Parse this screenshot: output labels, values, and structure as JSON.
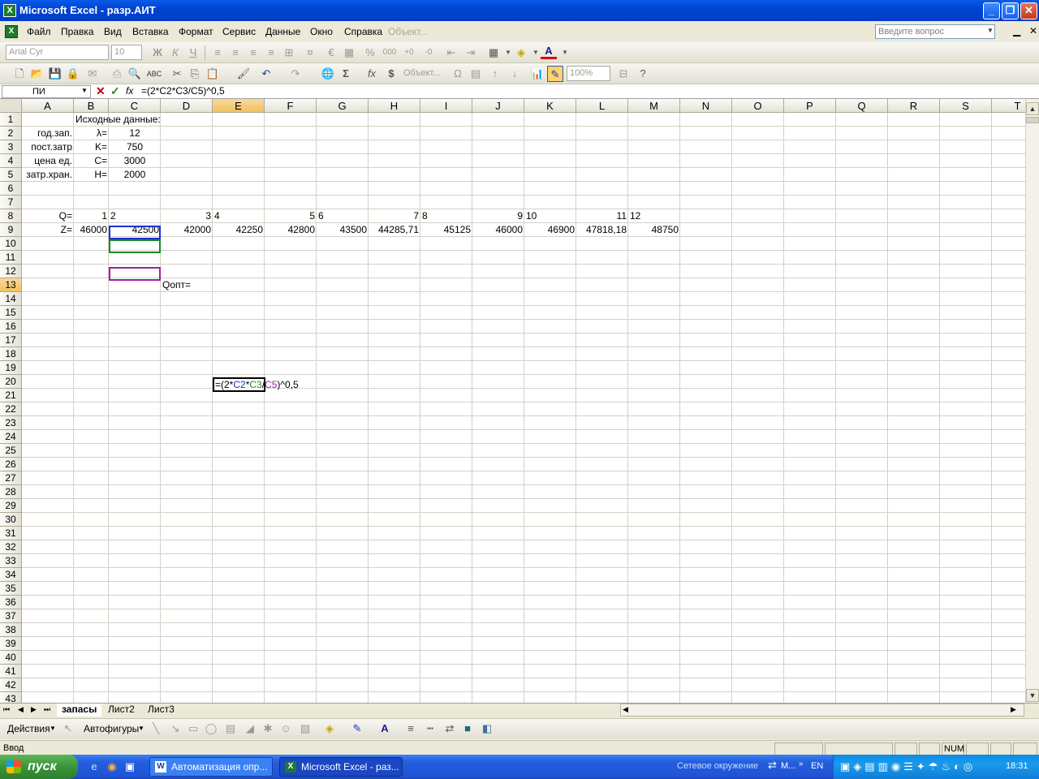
{
  "window": {
    "title": "Microsoft Excel - разр.АИТ",
    "app_icon": "excel-icon"
  },
  "menu": {
    "items": [
      "Файл",
      "Правка",
      "Вид",
      "Вставка",
      "Формат",
      "Сервис",
      "Данные",
      "Окно",
      "Справка"
    ],
    "disabled_item": "Объект...",
    "help_placeholder": "Введите вопрос"
  },
  "format_toolbar": {
    "font_name": "Arial Cyr",
    "font_size": "10"
  },
  "standard_toolbar": {
    "object_label": "Объект...",
    "zoom": "100%"
  },
  "formula_bar": {
    "name_box": "ПИ",
    "fx": "fx",
    "formula": "=(2*C2*C3/C5)^0,5"
  },
  "grid": {
    "columns": [
      "A",
      "B",
      "C",
      "D",
      "E",
      "F",
      "G",
      "H",
      "I",
      "J",
      "K",
      "L",
      "M",
      "N",
      "O",
      "P",
      "Q",
      "R",
      "S",
      "T"
    ],
    "selected_column": "E",
    "selected_row": "13",
    "rows": [
      "1",
      "2",
      "3",
      "4",
      "5",
      "6",
      "7",
      "8",
      "9",
      "10",
      "11",
      "12",
      "13",
      "14",
      "15",
      "16",
      "17",
      "18",
      "19",
      "20",
      "21",
      "22",
      "23",
      "24",
      "25",
      "26",
      "27",
      "28",
      "29",
      "30",
      "31",
      "32",
      "33",
      "34",
      "35",
      "36",
      "37",
      "38",
      "39",
      "40",
      "41",
      "42",
      "43"
    ],
    "cells": {
      "B1": "Исходные данные:",
      "A2": "год.зап.",
      "B2": "λ=",
      "C2": "12",
      "A3": "пост.затр",
      "B3": "K=",
      "C3": "750",
      "A4": "цена ед.",
      "B4": "C=",
      "C4": "3000",
      "A5": "затр.хран.",
      "B5": "H=",
      "C5": "2000",
      "A8": "Q=",
      "B8": "1",
      "C8": "2",
      "D8": "3",
      "E8": "4",
      "F8": "5",
      "G8": "6",
      "H8": "7",
      "I8": "8",
      "J8": "9",
      "K8": "10",
      "L8": "11",
      "M8": "12",
      "A9": "Z=",
      "B9": "46000",
      "C9": "42500",
      "D9": "42000",
      "E9": "42250",
      "F9": "42800",
      "G9": "43500",
      "H9": "44285,71",
      "I9": "45125",
      "J9": "46000",
      "K9": "46900",
      "L9": "47818,18",
      "M9": "48750",
      "D13": "Qопт=",
      "E13": "=(2*C2*C3/C5)^0,5"
    },
    "edit_formula_parts": [
      "=(2*",
      "C2",
      "*",
      "C3",
      "/",
      "C5",
      ")^0,5"
    ],
    "ref_colors": {
      "C2": "#1E2FD0",
      "C3": "#1C8A2C",
      "C5": "#A020A0"
    }
  },
  "sheets": {
    "tabs": [
      "запасы",
      "Лист2",
      "Лист3"
    ],
    "active": "запасы"
  },
  "draw_toolbar": {
    "actions": "Действия",
    "autoshapes": "Автофигуры"
  },
  "status": {
    "mode": "Ввод",
    "num": "NUM"
  },
  "taskbar": {
    "start": "пуск",
    "buttons": [
      "Автоматизация опр...",
      "Microsoft Excel - раз..."
    ],
    "network": "Сетевое окружение",
    "tray_m": "М...",
    "lang": "EN",
    "clock": "18:31"
  }
}
